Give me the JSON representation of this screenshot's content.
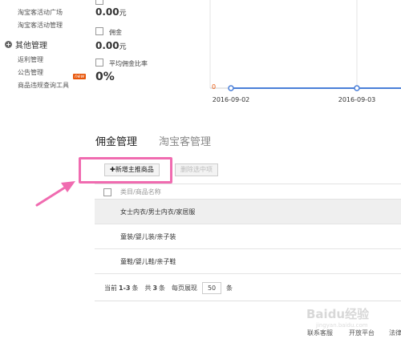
{
  "sidebar": {
    "top_links": [
      "淘宝客活动广场",
      "淘宝客活动管理"
    ],
    "section_title": "其他管理",
    "section_links": [
      "返利管理",
      "公告管理",
      "商品违规查询工具"
    ],
    "new_badge": "new"
  },
  "stats": [
    {
      "label": "",
      "value": "0.00",
      "unit": "元"
    },
    {
      "label": "佣金",
      "value": "0.00",
      "unit": "元"
    },
    {
      "label": "平均佣金比率",
      "value": "0%",
      "unit": ""
    }
  ],
  "chart_data": {
    "type": "line",
    "x": [
      "2016-09-02",
      "2016-09-03"
    ],
    "series": [
      {
        "values": [
          0,
          0
        ]
      }
    ],
    "y_tick_labels": [
      "0"
    ],
    "colors": {
      "line": "#4a7fd8",
      "axis": "#cfcfcf",
      "zero_label": "#e8560a"
    }
  },
  "tabs": [
    {
      "label": "佣金管理",
      "active": true
    },
    {
      "label": "淘宝客管理",
      "active": false
    }
  ],
  "toolbar": {
    "add_label": "✚新增主推商品",
    "delete_label": "删除选中项"
  },
  "table": {
    "header": "类目/商品名称",
    "rows": [
      "女士内衣/男士内衣/家居服",
      "童装/婴儿装/亲子装",
      "童鞋/婴儿鞋/亲子鞋"
    ]
  },
  "pagination": {
    "current_label": "当前",
    "range": "1-3",
    "unit": "条",
    "total_label": "共",
    "total": "3",
    "per_page_label": "每页展现",
    "per_page": "50"
  },
  "footer": {
    "links": [
      "联系客服",
      "开放平台",
      "法律"
    ]
  },
  "watermark": {
    "text": "Baidu经验",
    "sub": "jingyan.baidu.com"
  },
  "colors": {
    "highlight": "#f06bb0",
    "arrow": "#f06bb0",
    "badge": "#e8560a"
  }
}
